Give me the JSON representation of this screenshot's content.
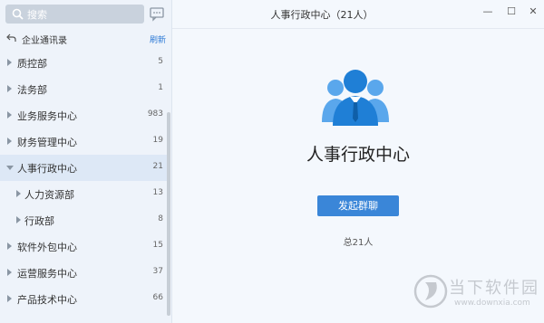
{
  "sidebar": {
    "search": {
      "placeholder": "搜索",
      "icon": "search-icon"
    },
    "message_icon": "message-icon",
    "contacts": {
      "title": "企业通讯录",
      "refresh_label": "刷新",
      "back_icon": "back-arrow-icon"
    },
    "departments": [
      {
        "name": "质控部",
        "count": "5",
        "level": 0,
        "expanded": false,
        "selected": false
      },
      {
        "name": "法务部",
        "count": "1",
        "level": 0,
        "expanded": false,
        "selected": false
      },
      {
        "name": "业务服务中心",
        "count": "983",
        "level": 0,
        "expanded": false,
        "selected": false
      },
      {
        "name": "财务管理中心",
        "count": "19",
        "level": 0,
        "expanded": false,
        "selected": false
      },
      {
        "name": "人事行政中心",
        "count": "21",
        "level": 0,
        "expanded": true,
        "selected": true
      },
      {
        "name": "人力资源部",
        "count": "13",
        "level": 1,
        "expanded": false,
        "selected": false
      },
      {
        "name": "行政部",
        "count": "8",
        "level": 1,
        "expanded": false,
        "selected": false
      },
      {
        "name": "软件外包中心",
        "count": "15",
        "level": 0,
        "expanded": false,
        "selected": false
      },
      {
        "name": "运营服务中心",
        "count": "37",
        "level": 0,
        "expanded": false,
        "selected": false
      },
      {
        "name": "产品技术中心",
        "count": "66",
        "level": 0,
        "expanded": false,
        "selected": false
      }
    ]
  },
  "main": {
    "window_title": "人事行政中心（21人）",
    "window_buttons": {
      "minimize": "—",
      "maximize": "☐",
      "close": "✕"
    },
    "group_name": "人事行政中心",
    "start_chat_label": "发起群聊",
    "member_total": "总21人"
  },
  "watermark": {
    "name": "当下软件园",
    "url": "www.downxia.com"
  },
  "colors": {
    "accent": "#3a86d8",
    "avatar_blue": "#2f8ee0",
    "selected_row": "#dde8f6"
  }
}
